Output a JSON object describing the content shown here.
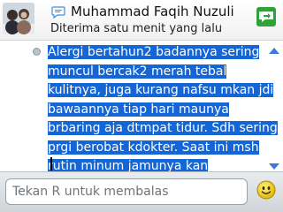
{
  "header": {
    "contact_name": "Muhammad Faqih Nuzuli",
    "status_text": "Diterima satu menit yang lalu",
    "avatar_icon": "profile-photo",
    "app_icon": "bbm-chat-icon",
    "presence_icon": "bbm-contact-icon"
  },
  "conversation": {
    "message": "Alergi bertahun2 badannya sering muncul bercak2 merah tebal kulitnya, juga kurang nafsu mkan jdi bawaannya tiap hari maunya brbaring aja dtmpat tidur. Sdh sering prgi berobat kdokter. Saat ini msh rutin minum jamunya kan",
    "highlight_color": "#1465d6"
  },
  "composer": {
    "placeholder": "Tekan R untuk membalas",
    "emoji_icon": "smiley-icon"
  }
}
